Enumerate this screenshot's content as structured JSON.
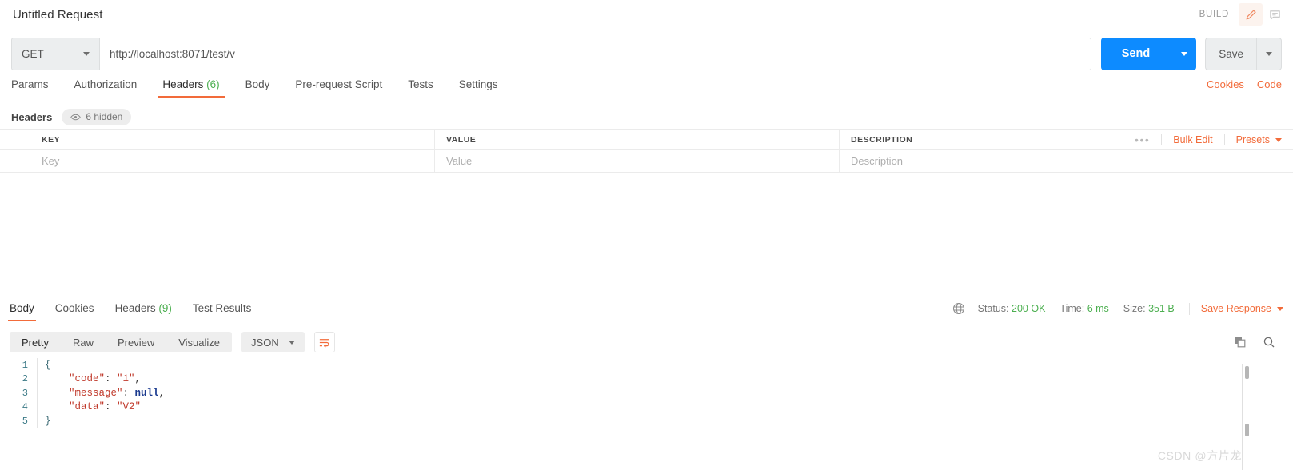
{
  "titlebar": {
    "request_title": "Untitled Request",
    "build_label": "BUILD",
    "edit_icon": "pencil-icon",
    "comment_icon": "comment-icon"
  },
  "urlbar": {
    "method": "GET",
    "url_value": "http://localhost:8071/test/v",
    "send_label": "Send",
    "save_label": "Save"
  },
  "request_tabs": {
    "items": [
      {
        "label": "Params",
        "count": "",
        "active": false
      },
      {
        "label": "Authorization",
        "count": "",
        "active": false
      },
      {
        "label": "Headers",
        "count": "(6)",
        "active": true
      },
      {
        "label": "Body",
        "count": "",
        "active": false
      },
      {
        "label": "Pre-request Script",
        "count": "",
        "active": false
      },
      {
        "label": "Tests",
        "count": "",
        "active": false
      },
      {
        "label": "Settings",
        "count": "",
        "active": false
      }
    ],
    "cookies_link": "Cookies",
    "code_link": "Code"
  },
  "headers_panel": {
    "section_label": "Headers",
    "hidden_pill": "6 hidden",
    "eye_icon": "eye-icon",
    "columns": [
      "KEY",
      "VALUE",
      "DESCRIPTION"
    ],
    "row_placeholders": [
      "Key",
      "Value",
      "Description"
    ],
    "more_icon": "ellipsis-icon",
    "bulk_edit": "Bulk Edit",
    "presets": "Presets"
  },
  "response": {
    "tabs": [
      {
        "label": "Body",
        "count": "",
        "active": true
      },
      {
        "label": "Cookies",
        "count": "",
        "active": false
      },
      {
        "label": "Headers",
        "count": "(9)",
        "active": false
      },
      {
        "label": "Test Results",
        "count": "",
        "active": false
      }
    ],
    "globe_icon": "globe-icon",
    "status_label": "Status:",
    "status_value": "200 OK",
    "time_label": "Time:",
    "time_value": "6 ms",
    "size_label": "Size:",
    "size_value": "351 B",
    "save_response": "Save Response"
  },
  "body_toolbar": {
    "views": [
      "Pretty",
      "Raw",
      "Preview",
      "Visualize"
    ],
    "active_view": "Pretty",
    "format": "JSON",
    "wrap_icon": "word-wrap-icon",
    "copy_icon": "copy-icon",
    "search_icon": "search-icon"
  },
  "code": {
    "lines": [
      {
        "num": "1",
        "tokens": [
          {
            "t": "brace",
            "v": "{"
          }
        ]
      },
      {
        "num": "2",
        "tokens": [
          {
            "t": "key",
            "v": "    \"code\""
          },
          {
            "t": "punc",
            "v": ": "
          },
          {
            "t": "str",
            "v": "\"1\""
          },
          {
            "t": "punc",
            "v": ","
          }
        ]
      },
      {
        "num": "3",
        "tokens": [
          {
            "t": "key",
            "v": "    \"message\""
          },
          {
            "t": "punc",
            "v": ": "
          },
          {
            "t": "null",
            "v": "null"
          },
          {
            "t": "punc",
            "v": ","
          }
        ]
      },
      {
        "num": "4",
        "tokens": [
          {
            "t": "key",
            "v": "    \"data\""
          },
          {
            "t": "punc",
            "v": ": "
          },
          {
            "t": "str",
            "v": "\"V2\""
          }
        ]
      },
      {
        "num": "5",
        "tokens": [
          {
            "t": "brace",
            "v": "}"
          }
        ]
      }
    ]
  },
  "watermark": "CSDN @方片龙",
  "colors": {
    "accent_orange": "#f26b3a",
    "send_blue": "#0d8bff",
    "status_green": "#4caf50"
  }
}
